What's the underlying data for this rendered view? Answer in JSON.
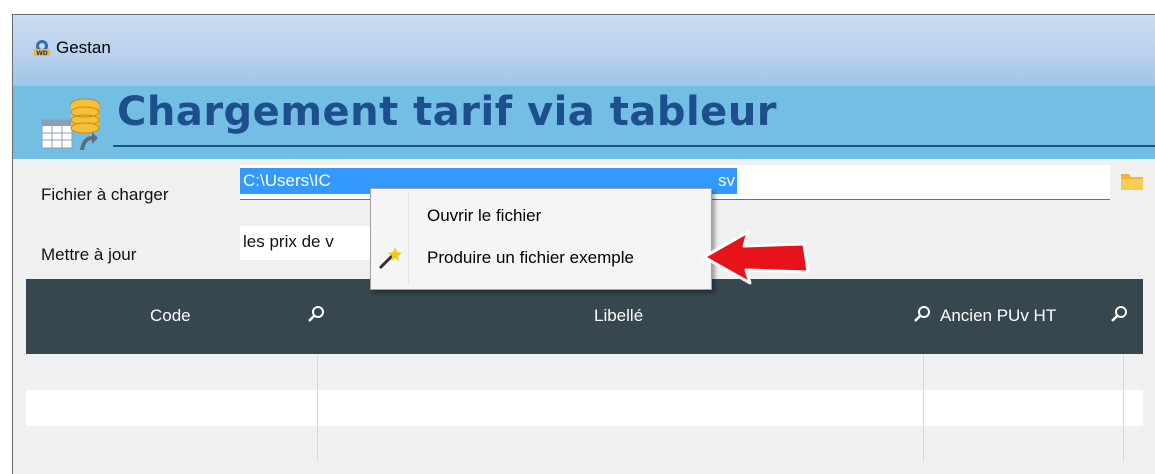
{
  "window": {
    "app_title": "Gestan",
    "page_title": "Chargement tarif via tableur"
  },
  "form": {
    "file_label": "Fichier à charger",
    "file_value_visible_start": "C:\\Users\\IC",
    "file_value_visible_end": "sv",
    "update_label": "Mettre à jour",
    "update_value": "les prix de v"
  },
  "table": {
    "columns": [
      "Code",
      "Libellé",
      "Ancien PUv HT"
    ],
    "rows": [
      [
        "",
        "",
        ""
      ],
      [
        "",
        "",
        ""
      ],
      [
        "",
        "",
        ""
      ]
    ]
  },
  "context_menu": {
    "items": [
      {
        "label": "Ouvrir le fichier",
        "icon": null
      },
      {
        "label": "Produire un fichier exemple",
        "icon": "magic-wand-icon"
      }
    ]
  },
  "colors": {
    "header_band": "#73bfe3",
    "title_text": "#1f4e8c",
    "table_header": "#36474f",
    "selection": "#3399ff",
    "arrow": "#e8131a"
  }
}
